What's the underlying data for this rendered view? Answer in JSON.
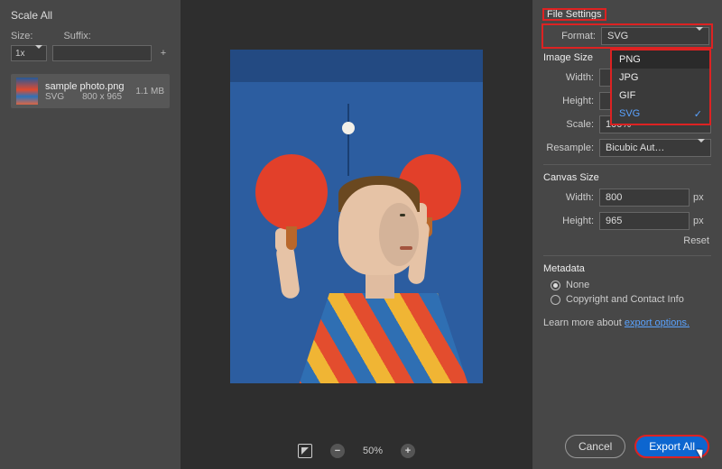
{
  "left": {
    "title": "Scale All",
    "size_label": "Size:",
    "suffix_label": "Suffix:",
    "multiplier": "1x",
    "add_icon": "+",
    "asset": {
      "name": "sample photo.png",
      "format": "SVG",
      "dims": "800 x 965",
      "filesize": "1.1 MB"
    }
  },
  "zoom": {
    "level": "50%"
  },
  "right": {
    "file_settings_title": "File Settings",
    "format_label": "Format:",
    "format_value": "SVG",
    "format_options": [
      "PNG",
      "JPG",
      "GIF",
      "SVG"
    ],
    "image_size_title": "Image Size",
    "width_label": "Width:",
    "height_label": "Height:",
    "scale_label": "Scale:",
    "scale_value": "100%",
    "resample_label": "Resample:",
    "resample_value": "Bicubic Aut…",
    "canvas_size_title": "Canvas Size",
    "canvas_width_label": "Width:",
    "canvas_width_value": "800",
    "canvas_height_label": "Height:",
    "canvas_height_value": "965",
    "unit": "px",
    "reset": "Reset",
    "metadata_title": "Metadata",
    "metadata_none": "None",
    "metadata_copyright": "Copyright and Contact Info",
    "learn_prefix": "Learn more about ",
    "learn_link": "export options."
  },
  "buttons": {
    "cancel": "Cancel",
    "export": "Export All"
  }
}
